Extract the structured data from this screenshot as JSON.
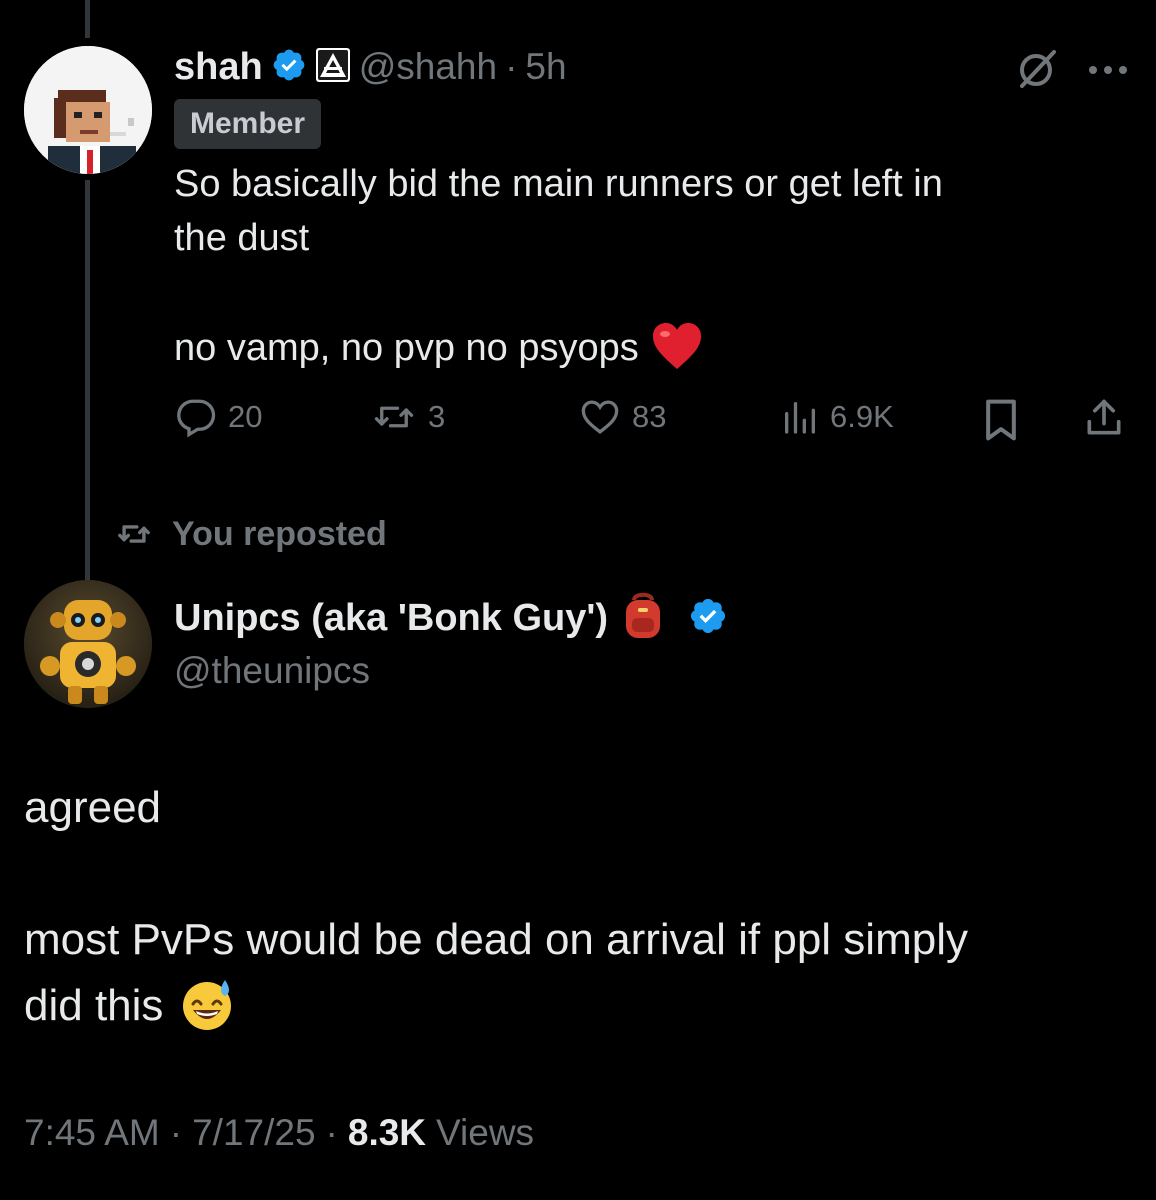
{
  "reply": {
    "display_name": "shah",
    "handle": "@shahh",
    "separator": "·",
    "time_ago": "5h",
    "affiliation_badge": "Member",
    "text_line1": "So basically bid the main runners or get left in",
    "text_line2": "the dust",
    "text_line3": "no vamp, no pvp no psyops",
    "emoji": "❤️",
    "icons": [
      "verified-badge-icon",
      "triangle-affiliate-icon",
      "grok-slash-icon",
      "more-icon"
    ],
    "replies": "20",
    "reposts": "3",
    "likes": "83",
    "views": "6.9K"
  },
  "repost_context": {
    "label": "You reposted"
  },
  "main_tweet": {
    "display_name": "Unipcs (aka 'Bonk Guy')",
    "emoji": "🎒",
    "handle": "@theunipcs",
    "text_line1": "agreed",
    "text_line2": "most PvPs would be dead on arrival if ppl simply",
    "text_line3": "did this",
    "text_emoji": "😅",
    "time": "7:45 AM",
    "date": "7/17/25",
    "separator": "·",
    "views_count": "8.3K",
    "views_label": "Views"
  },
  "colors": {
    "background": "#000000",
    "text": "#e7e9ea",
    "muted": "#71767b",
    "verified": "#1d9bf0"
  }
}
